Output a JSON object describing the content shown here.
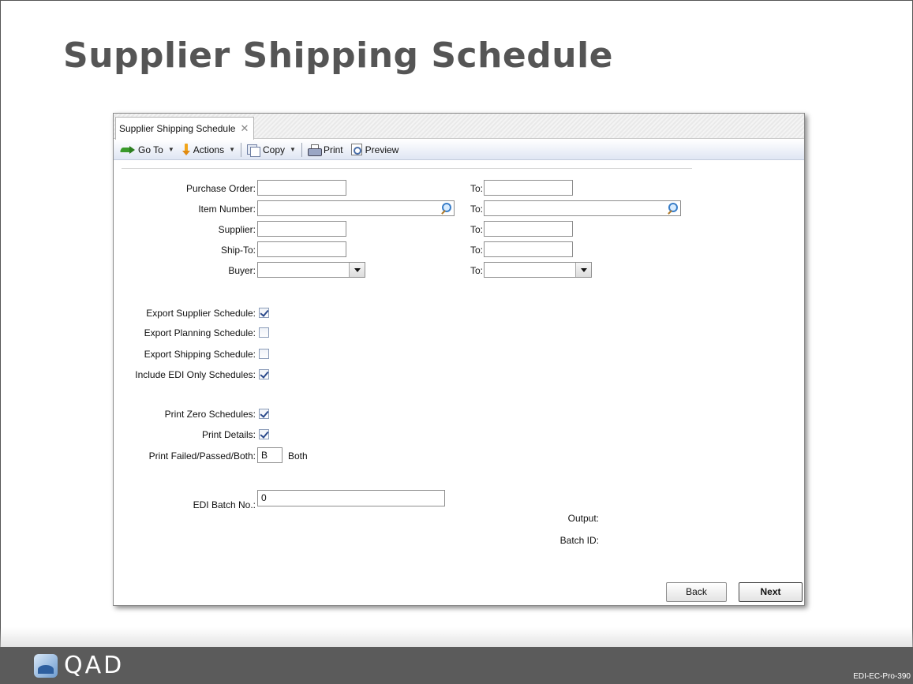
{
  "slide": {
    "title": "Supplier Shipping Schedule",
    "slide_id": "EDI-EC-Pro-390"
  },
  "footer": {
    "logo_text": "QAD"
  },
  "window": {
    "tab_label": "Supplier Shipping Schedule",
    "toolbar": {
      "goto_label": "Go To",
      "actions_label": "Actions",
      "copy_label": "Copy",
      "print_label": "Print",
      "preview_label": "Preview"
    },
    "form": {
      "to_label": "To:",
      "purchase_order": {
        "label": "Purchase Order:",
        "value": "",
        "to_value": ""
      },
      "item_number": {
        "label": "Item Number:",
        "value": "",
        "to_value": ""
      },
      "supplier": {
        "label": "Supplier:",
        "value": "",
        "to_value": ""
      },
      "ship_to": {
        "label": "Ship-To:",
        "value": "",
        "to_value": ""
      },
      "buyer": {
        "label": "Buyer:",
        "value": "",
        "to_value": ""
      },
      "export_supplier_schedule": {
        "label": "Export Supplier Schedule:",
        "checked": true
      },
      "export_planning_schedule": {
        "label": "Export Planning Schedule:",
        "checked": false
      },
      "export_shipping_schedule": {
        "label": "Export Shipping Schedule:",
        "checked": false
      },
      "include_edi_only": {
        "label": "Include EDI Only Schedules:",
        "checked": true
      },
      "print_zero_schedules": {
        "label": "Print Zero Schedules:",
        "checked": true
      },
      "print_details": {
        "label": "Print Details:",
        "checked": true
      },
      "print_failed_passed": {
        "label": "Print Failed/Passed/Both:",
        "value": "B",
        "description": "Both"
      },
      "edi_batch_no": {
        "label": "EDI Batch No.:",
        "value": "0"
      },
      "output_label": "Output:",
      "batch_id_label": "Batch ID:"
    },
    "buttons": {
      "back": "Back",
      "next": "Next"
    }
  }
}
